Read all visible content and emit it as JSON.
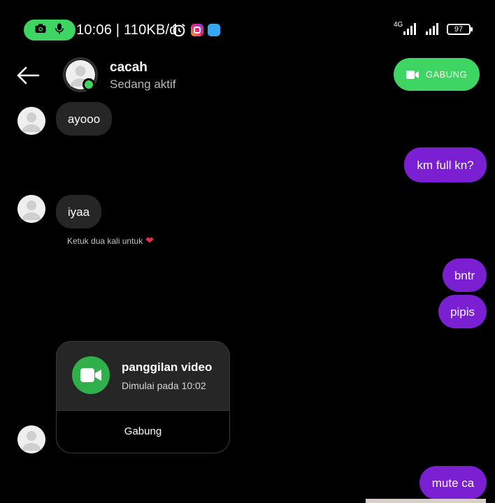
{
  "status_bar": {
    "time_speed": "10:06 | 110KB/d",
    "network": "4G",
    "battery": "97",
    "icons": [
      "camera-icon",
      "microphone-icon",
      "alarm-icon",
      "instagram-icon",
      "app-icon",
      "signal-icon",
      "battery-icon"
    ]
  },
  "header": {
    "contact_name": "cacah",
    "contact_status": "Sedang aktif",
    "join_button_label": "GABUNG"
  },
  "messages": [
    {
      "from": "them",
      "text": "ayooo"
    },
    {
      "from": "me",
      "text": "km full kn?"
    },
    {
      "from": "them",
      "text": "iyaa"
    },
    {
      "from": "me",
      "text": "bntr"
    },
    {
      "from": "me",
      "text": "pipis"
    },
    {
      "from": "me",
      "text": "mute ca"
    }
  ],
  "reaction_hint": "Ketuk dua kali untuk",
  "video_call": {
    "title": "panggilan video",
    "subtitle": "Dimulai pada 10:02",
    "join_label": "Gabung"
  },
  "colors": {
    "accent_green": "#3fd562",
    "outgoing_bubble": "#7a1fd1",
    "incoming_bubble": "#262626",
    "heart": "#e8324a"
  }
}
